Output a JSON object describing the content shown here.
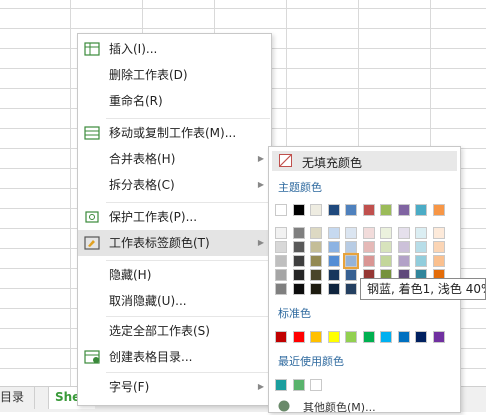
{
  "sheet_tabs": [
    {
      "label": "目录"
    },
    {
      "label": "She"
    }
  ],
  "menu": {
    "items": [
      {
        "label": "插入(I)...",
        "icon": "insert-sheet-icon",
        "submenu": false
      },
      {
        "label": "删除工作表(D)",
        "icon": "",
        "submenu": false
      },
      {
        "label": "重命名(R)",
        "icon": "",
        "submenu": false
      },
      {
        "label": "移动或复制工作表(M)...",
        "icon": "move-copy-sheet-icon",
        "submenu": false
      },
      {
        "label": "合并表格(H)",
        "icon": "",
        "submenu": true
      },
      {
        "label": "拆分表格(C)",
        "icon": "",
        "submenu": true
      },
      {
        "label": "保护工作表(P)...",
        "icon": "protect-sheet-icon",
        "submenu": false
      },
      {
        "label": "工作表标签颜色(T)",
        "icon": "tab-color-icon",
        "submenu": true,
        "highlighted": true
      },
      {
        "label": "隐藏(H)",
        "icon": "",
        "submenu": false
      },
      {
        "label": "取消隐藏(U)...",
        "icon": "",
        "submenu": false
      },
      {
        "label": "选定全部工作表(S)",
        "icon": "",
        "submenu": false
      },
      {
        "label": "创建表格目录...",
        "icon": "create-toc-icon",
        "submenu": false
      },
      {
        "label": "字号(F)",
        "icon": "",
        "submenu": true
      }
    ]
  },
  "palette": {
    "no_fill": "无填充颜色",
    "theme_title": "主题颜色",
    "standard_title": "标准色",
    "recent_title": "最近使用颜色",
    "more_colors": "其他颜色(M)...",
    "theme_colors": [
      "#ffffff",
      "#000000",
      "#eeece1",
      "#1f497d",
      "#4f81bd",
      "#c0504d",
      "#9bbb59",
      "#8064a2",
      "#4bacc6",
      "#f79646"
    ],
    "theme_shades": [
      [
        "#f2f2f2",
        "#7f7f7f",
        "#ddd9c3",
        "#c6d9f0",
        "#dbe5f1",
        "#f2dcdb",
        "#ebf1dd",
        "#e5e0ec",
        "#dbeef3",
        "#fdeada"
      ],
      [
        "#d8d8d8",
        "#595959",
        "#c4bd97",
        "#8db3e2",
        "#b8cce4",
        "#e5b9b7",
        "#d7e3bc",
        "#ccc1d9",
        "#b7dde8",
        "#fbd5b5"
      ],
      [
        "#bfbfbf",
        "#3f3f3f",
        "#938953",
        "#548dd4",
        "#95b3d7",
        "#d99694",
        "#c3d69b",
        "#b2a2c7",
        "#92cddc",
        "#fac08f"
      ],
      [
        "#a5a5a5",
        "#262626",
        "#494429",
        "#17365d",
        "#366092",
        "#953734",
        "#76923c",
        "#5f497a",
        "#31859b",
        "#e36c09"
      ],
      [
        "#7f7f7f",
        "#0c0c0c",
        "#1d1b10",
        "#0f243e",
        "#244061",
        "#632423",
        "#4f6128",
        "#3f3151",
        "#205867",
        "#974806"
      ]
    ],
    "selected_swatch": {
      "row": 2,
      "col": 4
    },
    "standard_colors": [
      "#c00000",
      "#ff0000",
      "#ffc000",
      "#ffff00",
      "#92d050",
      "#00b050",
      "#00b0f0",
      "#0070c0",
      "#002060",
      "#7030a0"
    ],
    "recent_colors": [
      "#1a9e9e",
      "#59b36c",
      "#ffffff"
    ],
    "tooltip": "钢蓝, 着色1, 浅色 40%"
  }
}
